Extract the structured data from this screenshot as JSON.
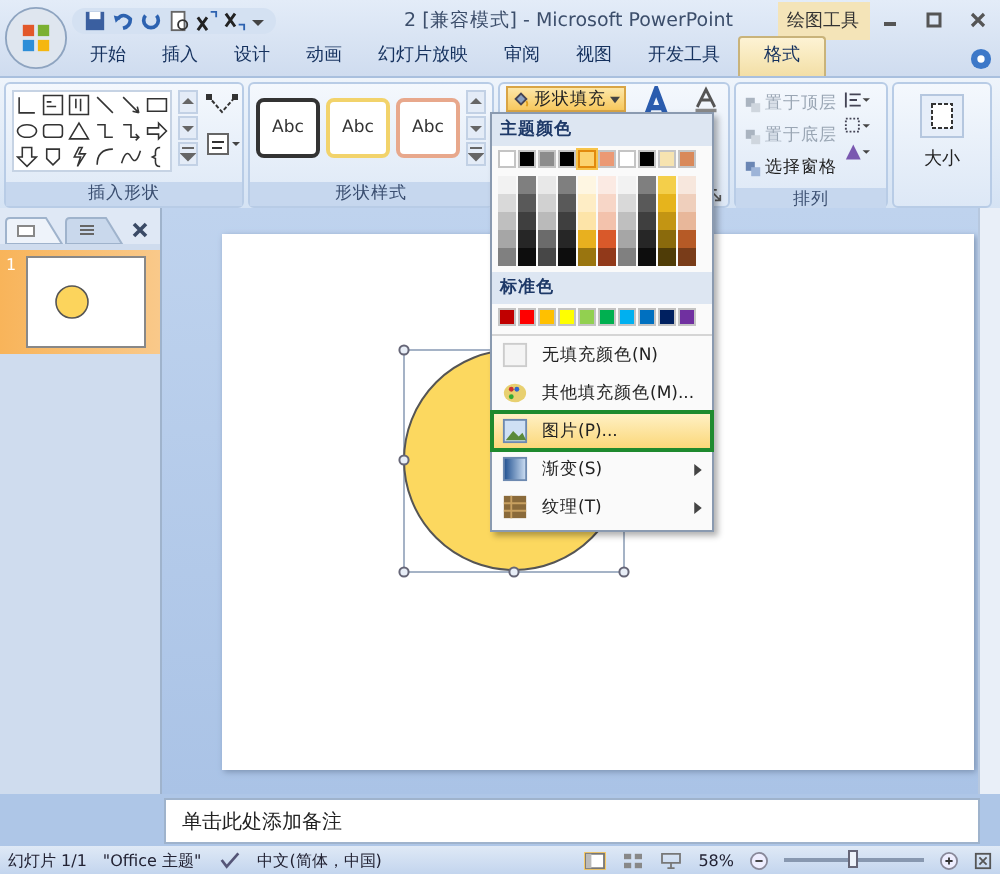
{
  "window": {
    "title": "2 [兼容模式] - Microsoft PowerPoint",
    "context_title": "绘图工具"
  },
  "tabs": [
    {
      "label": "开始",
      "selected": false
    },
    {
      "label": "插入",
      "selected": false
    },
    {
      "label": "设计",
      "selected": false
    },
    {
      "label": "动画",
      "selected": false
    },
    {
      "label": "幻灯片放映",
      "selected": false
    },
    {
      "label": "审阅",
      "selected": false
    },
    {
      "label": "视图",
      "selected": false
    },
    {
      "label": "开发工具",
      "selected": false
    },
    {
      "label": "格式",
      "selected": true
    }
  ],
  "ribbon": {
    "groups": [
      {
        "label": "插入形状"
      },
      {
        "label": "形状样式"
      },
      {
        "label": "排列"
      }
    ],
    "style_presets": [
      {
        "label": "Abc",
        "color": "#333333"
      },
      {
        "label": "Abc",
        "color": "#f2d36b"
      },
      {
        "label": "Abc",
        "color": "#e8a88c"
      }
    ],
    "fill_button": {
      "label": "形状填充",
      "expanded": true
    },
    "arrange": [
      {
        "label": "置于顶层",
        "disabled": true
      },
      {
        "label": "置于底层",
        "disabled": true
      },
      {
        "label": "选择窗格",
        "disabled": false
      }
    ],
    "size_button": {
      "label": "大小"
    }
  },
  "fill_menu": {
    "theme_header": "主题颜色",
    "theme_columns": [
      {
        "color": "#ffffff",
        "selected": false,
        "shades": [
          {
            "color": "#f2f2f2"
          },
          {
            "color": "#d9d9d9"
          },
          {
            "color": "#bfbfbf"
          },
          {
            "color": "#a6a6a6"
          },
          {
            "color": "#808080"
          }
        ]
      },
      {
        "color": "#000000",
        "selected": false,
        "shades": [
          {
            "color": "#7f7f7f"
          },
          {
            "color": "#595959"
          },
          {
            "color": "#3f3f3f"
          },
          {
            "color": "#262626"
          },
          {
            "color": "#0d0d0d"
          }
        ]
      },
      {
        "color": "#8c8c8c",
        "selected": false,
        "shades": [
          {
            "color": "#e8e8e8"
          },
          {
            "color": "#d1d1d1"
          },
          {
            "color": "#bababa"
          },
          {
            "color": "#6b6b6b"
          },
          {
            "color": "#474747"
          }
        ]
      },
      {
        "color": "#000000",
        "selected": false,
        "shades": [
          {
            "color": "#7f7f7f"
          },
          {
            "color": "#595959"
          },
          {
            "color": "#3f3f3f"
          },
          {
            "color": "#262626"
          },
          {
            "color": "#0d0d0d"
          }
        ]
      },
      {
        "color": "#fcd36f",
        "selected": true,
        "shades": [
          {
            "color": "#fef6e2"
          },
          {
            "color": "#feedc5"
          },
          {
            "color": "#fde4a8"
          },
          {
            "color": "#e8b01f"
          },
          {
            "color": "#9a750f"
          }
        ]
      },
      {
        "color": "#eb9974",
        "selected": false,
        "shades": [
          {
            "color": "#fbeae3"
          },
          {
            "color": "#f7d6c7"
          },
          {
            "color": "#f3c2ac"
          },
          {
            "color": "#d9592a"
          },
          {
            "color": "#91391a"
          }
        ]
      },
      {
        "color": "#ffffff",
        "selected": false,
        "shades": [
          {
            "color": "#f2f2f2"
          },
          {
            "color": "#d9d9d9"
          },
          {
            "color": "#bfbfbf"
          },
          {
            "color": "#a6a6a6"
          },
          {
            "color": "#808080"
          }
        ]
      },
      {
        "color": "#000000",
        "selected": false,
        "shades": [
          {
            "color": "#7f7f7f"
          },
          {
            "color": "#595959"
          },
          {
            "color": "#3f3f3f"
          },
          {
            "color": "#262626"
          },
          {
            "color": "#0d0d0d"
          }
        ]
      },
      {
        "color": "#f6e3b0",
        "selected": false,
        "shades": [
          {
            "color": "#f4cf4a"
          },
          {
            "color": "#e6b41c"
          },
          {
            "color": "#c39513"
          },
          {
            "color": "#8a6a0c"
          },
          {
            "color": "#4f3c07"
          }
        ]
      },
      {
        "color": "#d9895a",
        "selected": false,
        "shades": [
          {
            "color": "#f7e7dd"
          },
          {
            "color": "#efcfbc"
          },
          {
            "color": "#e8b79a"
          },
          {
            "color": "#b65a26"
          },
          {
            "color": "#793c19"
          }
        ]
      }
    ],
    "standard_header": "标准色",
    "standard_colors": [
      {
        "color": "#c00000"
      },
      {
        "color": "#ff0000"
      },
      {
        "color": "#ffc000"
      },
      {
        "color": "#ffff00"
      },
      {
        "color": "#92d050"
      },
      {
        "color": "#00b050"
      },
      {
        "color": "#00b0f0"
      },
      {
        "color": "#0070c0"
      },
      {
        "color": "#002060"
      },
      {
        "color": "#7030a0"
      }
    ],
    "items": [
      {
        "label": "无填充颜色(N)",
        "kind": "none",
        "selected": false,
        "submenu": false
      },
      {
        "label": "其他填充颜色(M)...",
        "kind": "palette",
        "selected": false,
        "submenu": false
      },
      {
        "label": "图片(P)...",
        "kind": "picture",
        "selected": true,
        "submenu": false
      },
      {
        "label": "渐变(S)",
        "kind": "gradient",
        "selected": false,
        "submenu": true
      },
      {
        "label": "纹理(T)",
        "kind": "texture",
        "selected": false,
        "submenu": true
      }
    ]
  },
  "slides_panel": {
    "slides": [
      {
        "number": "1",
        "selected": true
      }
    ]
  },
  "notes": {
    "placeholder": "单击此处添加备注"
  },
  "status_bar": {
    "slide": "幻灯片 1/1",
    "theme": "\"Office 主题\"",
    "language": "中文(简体，中国)",
    "zoom": "58%",
    "zoom_level": {
      "level": 0.5
    }
  }
}
